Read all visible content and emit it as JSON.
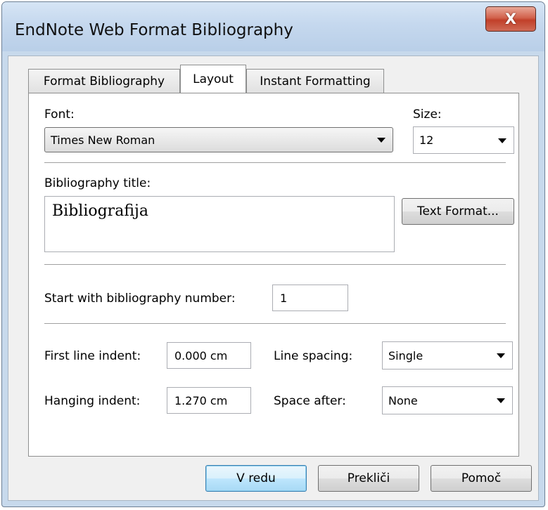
{
  "window": {
    "title": "EndNote Web Format Bibliography",
    "close_label": "X"
  },
  "tabs": [
    {
      "label": "Format Bibliography",
      "active": false
    },
    {
      "label": "Layout",
      "active": true
    },
    {
      "label": "Instant Formatting",
      "active": false
    }
  ],
  "layout": {
    "font_label": "Font:",
    "font_value": "Times New Roman",
    "size_label": "Size:",
    "size_value": "12",
    "bib_title_label": "Bibliography title:",
    "bib_title_value": "Bibliografija",
    "text_format_button": "Text Format...",
    "start_number_label": "Start with bibliography number:",
    "start_number_value": "1",
    "first_line_indent_label": "First line indent:",
    "first_line_indent_value": "0.000 cm",
    "hanging_indent_label": "Hanging indent:",
    "hanging_indent_value": "1.270 cm",
    "line_spacing_label": "Line spacing:",
    "line_spacing_value": "Single",
    "space_after_label": "Space after:",
    "space_after_value": "None"
  },
  "buttons": {
    "ok": "V redu",
    "cancel": "Prekliči",
    "help": "Pomoč"
  }
}
